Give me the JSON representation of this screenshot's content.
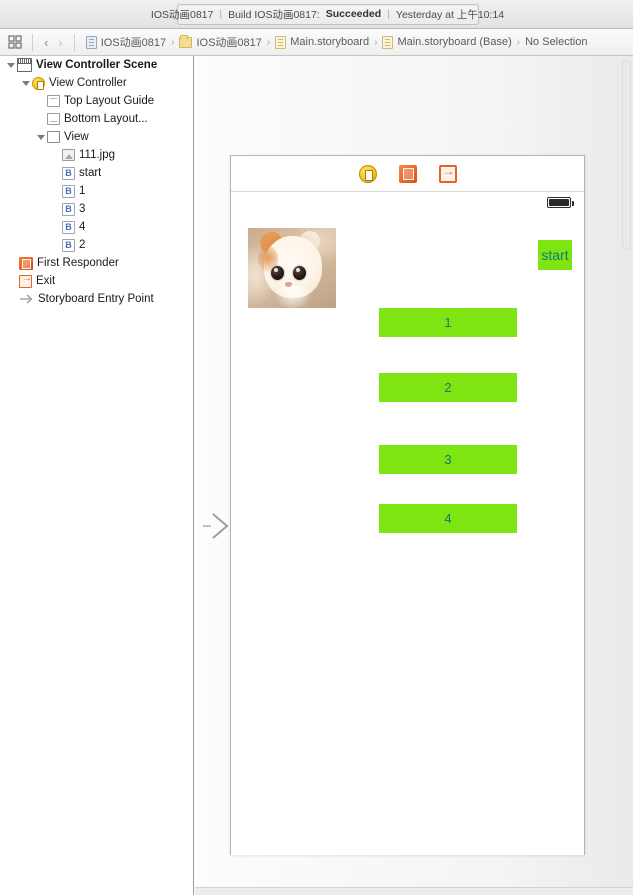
{
  "toolbar": {
    "project_name": "IOS动画0817",
    "separator": "|",
    "build_status_prefix": "Build IOS动画0817:",
    "build_status": "Succeeded",
    "timestamp": "Yesterday at 上午10:14"
  },
  "jumpbar": {
    "related_items_icon": "grid-icon",
    "back_chevron": "‹",
    "forward_chevron": "›",
    "crumbs": [
      {
        "label": "IOS动画0817",
        "icon": "project-icon"
      },
      {
        "label": "IOS动画0817",
        "icon": "folder-icon"
      },
      {
        "label": "Main.storyboard",
        "icon": "storyboard-icon"
      },
      {
        "label": "Main.storyboard (Base)",
        "icon": "storyboard-icon"
      },
      {
        "label": "No Selection",
        "icon": "none"
      }
    ],
    "crumb_separator": "›"
  },
  "outline": {
    "rows": [
      {
        "label": "View Controller Scene",
        "icon": "scene-icon",
        "indent": 0,
        "twisty": "open",
        "bold": true
      },
      {
        "label": "View Controller",
        "icon": "view-controller-icon",
        "indent": 1,
        "twisty": "open",
        "bold": false
      },
      {
        "label": "Top Layout Guide",
        "icon": "top-layout-guide-icon",
        "indent": 2,
        "twisty": "none",
        "bold": false
      },
      {
        "label": "Bottom Layout...",
        "icon": "bottom-layout-guide-icon",
        "indent": 2,
        "twisty": "none",
        "bold": false
      },
      {
        "label": "View",
        "icon": "view-icon",
        "indent": 2,
        "twisty": "open",
        "bold": false
      },
      {
        "label": "111.jpg",
        "icon": "image-view-icon",
        "indent": 3,
        "twisty": "none",
        "bold": false
      },
      {
        "label": "start",
        "icon": "button-icon",
        "indent": 3,
        "twisty": "none",
        "bold": false
      },
      {
        "label": "1",
        "icon": "button-icon",
        "indent": 3,
        "twisty": "none",
        "bold": false
      },
      {
        "label": "3",
        "icon": "button-icon",
        "indent": 3,
        "twisty": "none",
        "bold": false
      },
      {
        "label": "4",
        "icon": "button-icon",
        "indent": 3,
        "twisty": "none",
        "bold": false
      },
      {
        "label": "2",
        "icon": "button-icon",
        "indent": 3,
        "twisty": "none",
        "bold": false
      },
      {
        "label": "First Responder",
        "icon": "first-responder-icon",
        "indent": 0,
        "twisty": "none",
        "bold": false
      },
      {
        "label": "Exit",
        "icon": "exit-icon",
        "indent": 0,
        "twisty": "none",
        "bold": false
      },
      {
        "label": "Storyboard Entry Point",
        "icon": "entry-point-arrow-icon",
        "indent": 0,
        "twisty": "none",
        "bold": false
      }
    ]
  },
  "canvas": {
    "scene_dock": [
      {
        "name": "view-controller-dock-icon"
      },
      {
        "name": "first-responder-dock-icon"
      },
      {
        "name": "exit-dock-icon"
      }
    ],
    "status_bar": {
      "battery_icon": "battery-icon"
    },
    "image_view": {
      "name": "111.jpg",
      "alt": "cat photo"
    },
    "buttons": [
      {
        "label": "start",
        "kind": "start"
      },
      {
        "label": "1",
        "kind": "num"
      },
      {
        "label": "2",
        "kind": "num"
      },
      {
        "label": "3",
        "kind": "num"
      },
      {
        "label": "4",
        "kind": "num"
      }
    ],
    "entry_point_arrow": "storyboard-entry-point-arrow"
  },
  "colors": {
    "button_green": "#7FE512",
    "button_text_teal": "#0f7a75",
    "accent_orange": "#e8652a",
    "accent_yellow": "#f5c01a"
  }
}
